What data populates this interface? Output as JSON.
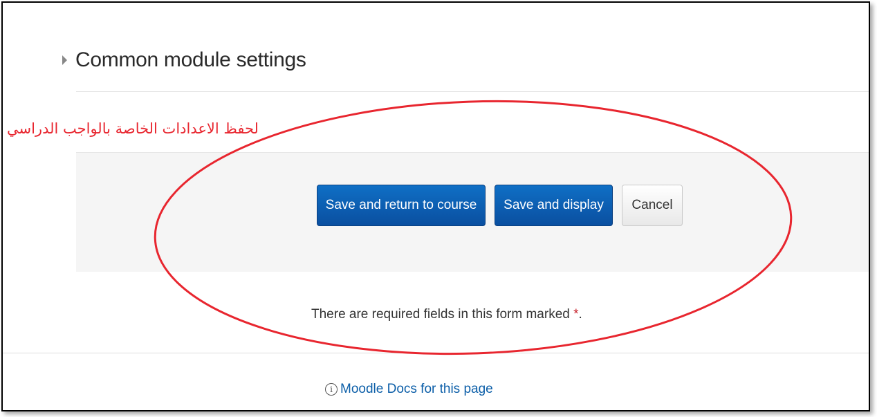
{
  "section": {
    "title": "Common module settings"
  },
  "annotation": {
    "arabic_text": "لحفظ الاعدادات الخاصة بالواجب الدراسي",
    "color": "#e8262f"
  },
  "actions": {
    "save_return_label": "Save and return to course",
    "save_display_label": "Save and display",
    "cancel_label": "Cancel"
  },
  "form": {
    "required_note": "There are required fields in this form marked",
    "required_marker": "*",
    "required_suffix": "."
  },
  "footer": {
    "docs_icon": "info-icon",
    "docs_link": "Moodle Docs for this page"
  },
  "colors": {
    "primary_button": "#0a4fa0",
    "link": "#0b5ea8"
  }
}
